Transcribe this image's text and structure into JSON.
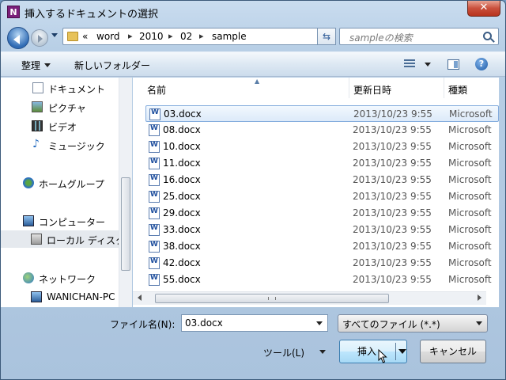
{
  "window": {
    "app_icon": "N",
    "title": "挿入するドキュメントの選択",
    "close_label": "✕"
  },
  "address": {
    "overflow": "«",
    "crumbs": [
      "word",
      "2010",
      "02",
      "sample"
    ],
    "separator": "▸"
  },
  "search": {
    "placeholder": "sampleの検索"
  },
  "toolbar": {
    "organize": "整理",
    "new_folder": "新しいフォルダー"
  },
  "nav": {
    "items": [
      {
        "label": "ドキュメント",
        "icon": "document-icon"
      },
      {
        "label": "ピクチャ",
        "icon": "picture-icon"
      },
      {
        "label": "ビデオ",
        "icon": "video-icon"
      },
      {
        "label": "ミュージック",
        "icon": "music-icon"
      },
      {
        "label": "ホームグループ",
        "icon": "homegroup-icon"
      },
      {
        "label": "コンピューター",
        "icon": "computer-icon"
      },
      {
        "label": "ローカル ディスク",
        "icon": "drive-icon"
      },
      {
        "label": "ネットワーク",
        "icon": "network-icon"
      },
      {
        "label": "WANICHAN-PC",
        "icon": "computer-icon"
      }
    ]
  },
  "columns": {
    "name": "名前",
    "date": "更新日時",
    "type": "種類"
  },
  "files": [
    {
      "name": "03.docx",
      "date": "2013/10/23 9:55",
      "type": "Microsoft"
    },
    {
      "name": "08.docx",
      "date": "2013/10/23 9:55",
      "type": "Microsoft"
    },
    {
      "name": "10.docx",
      "date": "2013/10/23 9:55",
      "type": "Microsoft"
    },
    {
      "name": "11.docx",
      "date": "2013/10/23 9:55",
      "type": "Microsoft"
    },
    {
      "name": "16.docx",
      "date": "2013/10/23 9:55",
      "type": "Microsoft"
    },
    {
      "name": "25.docx",
      "date": "2013/10/23 9:55",
      "type": "Microsoft"
    },
    {
      "name": "29.docx",
      "date": "2013/10/23 9:55",
      "type": "Microsoft"
    },
    {
      "name": "33.docx",
      "date": "2013/10/23 9:55",
      "type": "Microsoft"
    },
    {
      "name": "38.docx",
      "date": "2013/10/23 9:55",
      "type": "Microsoft"
    },
    {
      "name": "42.docx",
      "date": "2013/10/23 9:55",
      "type": "Microsoft"
    },
    {
      "name": "55.docx",
      "date": "2013/10/23 9:55",
      "type": "Microsoft"
    }
  ],
  "bottom": {
    "filename_label": "ファイル名(N):",
    "filename_value": "03.docx",
    "filter_value": "すべてのファイル (*.*)",
    "tools_label": "ツール(L)",
    "insert_label": "挿入",
    "cancel_label": "キャンセル"
  }
}
